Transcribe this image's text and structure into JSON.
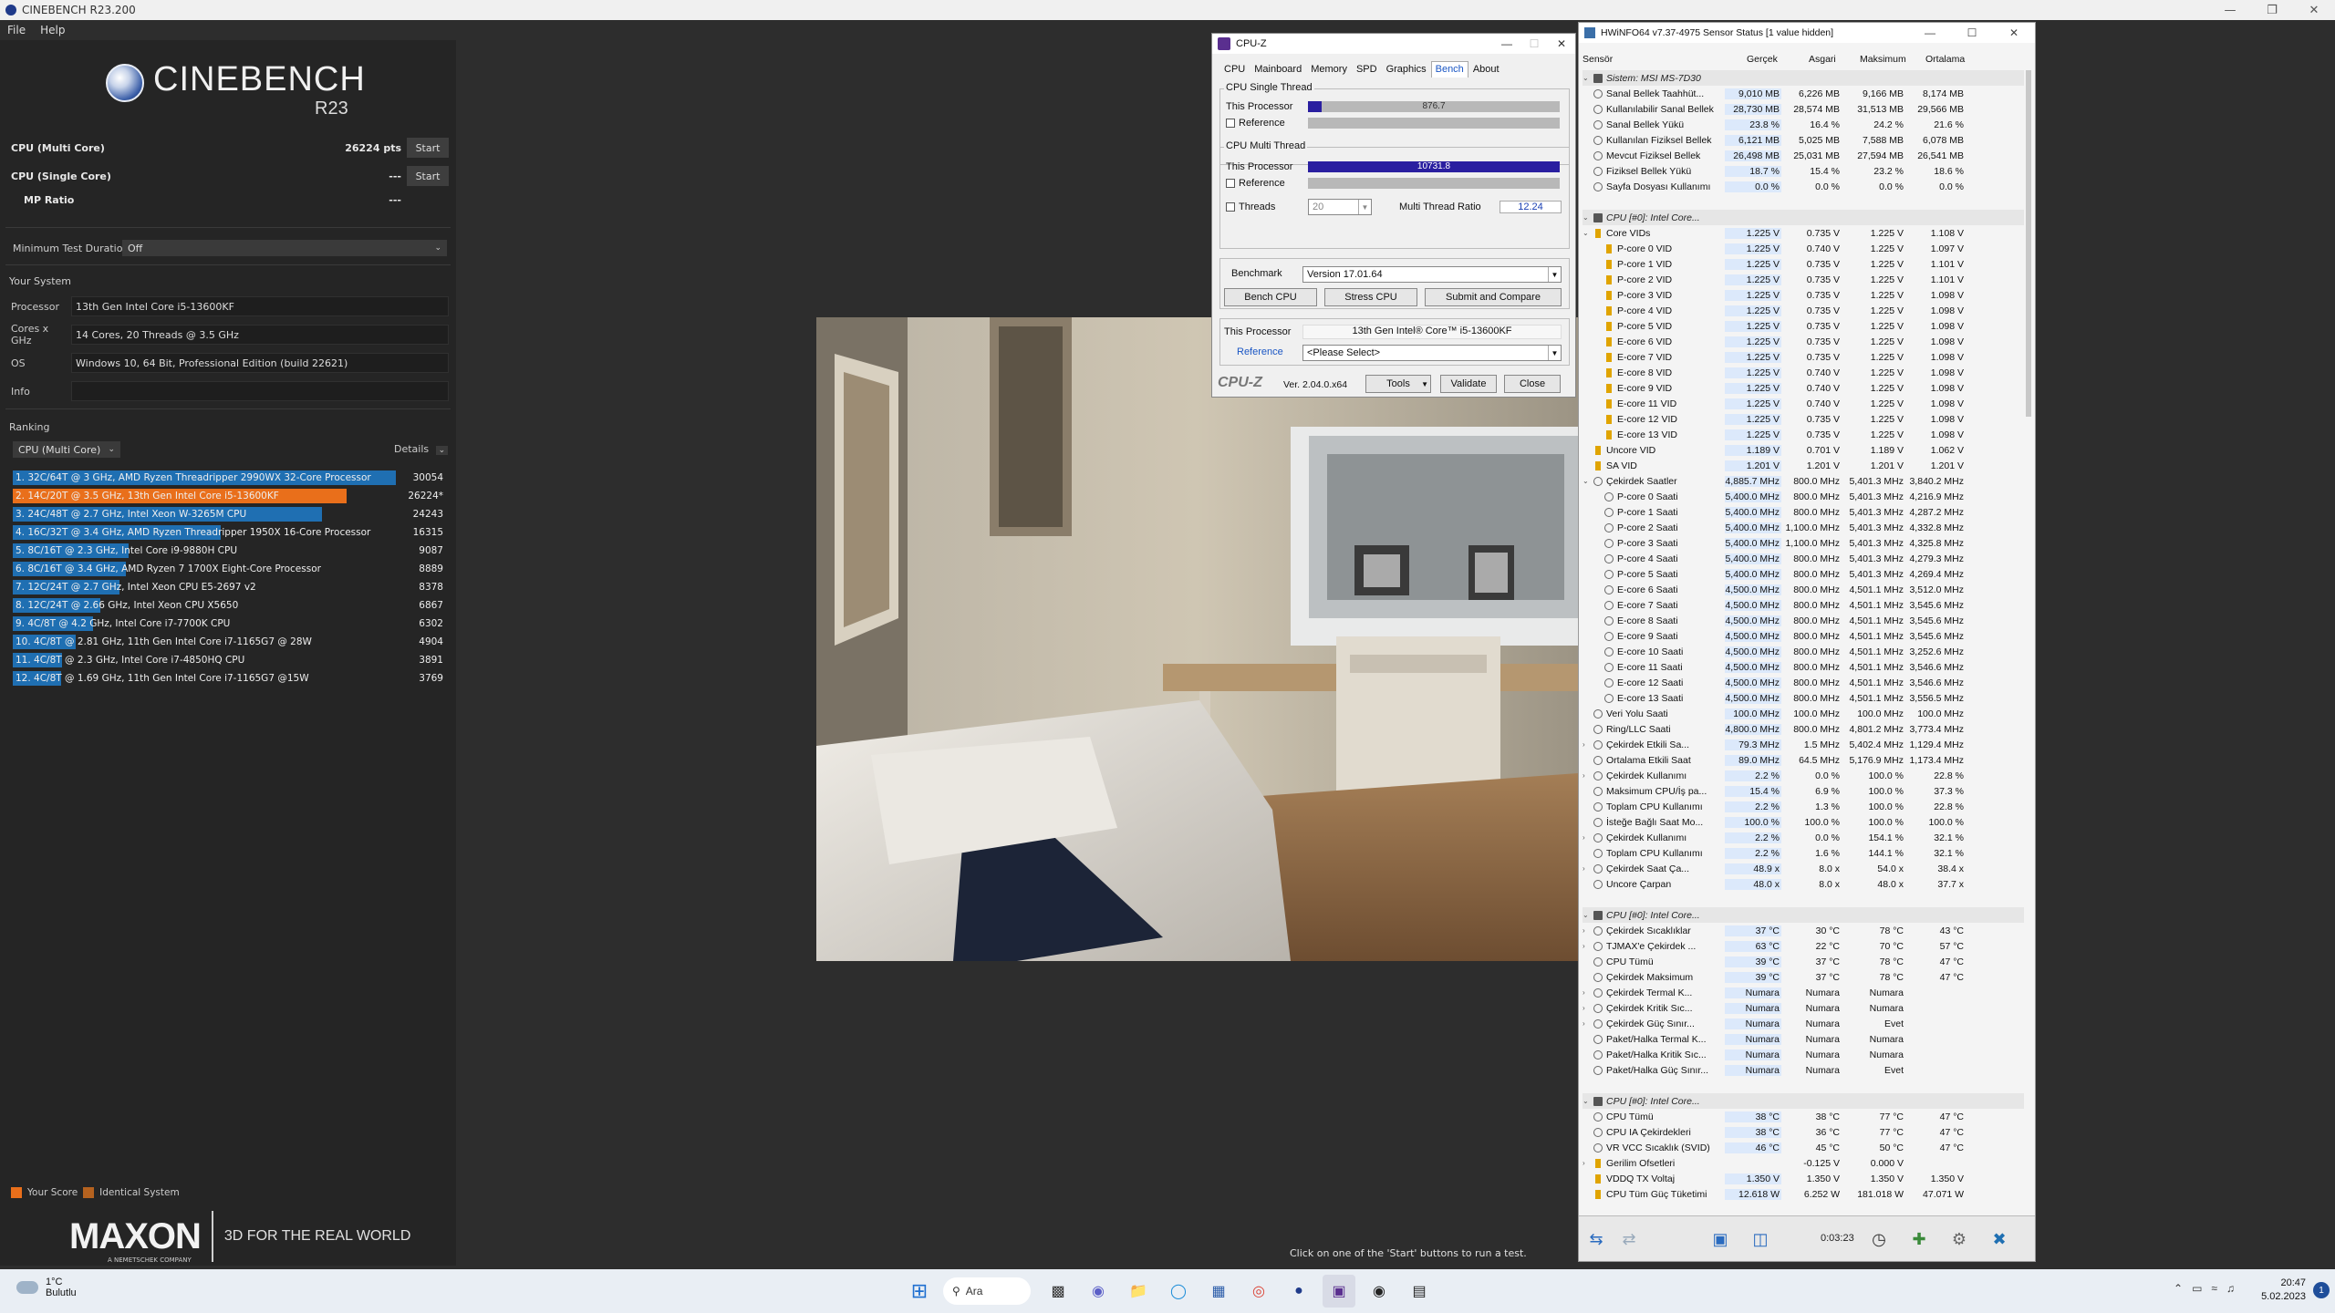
{
  "cinebench": {
    "title": "CINEBENCH R23.200",
    "menu": [
      "File",
      "Help"
    ],
    "logo_name": "CINEBENCH",
    "logo_version": "R23",
    "tests": [
      {
        "label": "CPU (Multi Core)",
        "score": "26224 pts",
        "button": "Start"
      },
      {
        "label": "CPU (Single Core)",
        "score": "---",
        "button": "Start"
      },
      {
        "label": "MP Ratio",
        "score": "---"
      }
    ],
    "min_duration_label": "Minimum Test Duration",
    "min_duration_value": "Off",
    "your_system_label": "Your System",
    "system": [
      {
        "label": "Processor",
        "value": "13th Gen Intel Core i5-13600KF"
      },
      {
        "label": "Cores x GHz",
        "value": "14 Cores, 20 Threads @ 3.5 GHz"
      },
      {
        "label": "OS",
        "value": "Windows 10, 64 Bit, Professional Edition (build 22621)"
      },
      {
        "label": "Info",
        "value": ""
      }
    ],
    "ranking_label": "Ranking",
    "ranking_filter": "CPU (Multi Core)",
    "details_label": "Details",
    "ranking": [
      {
        "text": "1. 32C/64T @ 3 GHz, AMD Ryzen Threadripper 2990WX 32-Core Processor",
        "score": "30054",
        "value": 30054,
        "you": false
      },
      {
        "text": "2. 14C/20T @ 3.5 GHz, 13th Gen Intel Core i5-13600KF",
        "score": "26224*",
        "value": 26224,
        "you": true
      },
      {
        "text": "3. 24C/48T @ 2.7 GHz, Intel Xeon W-3265M CPU",
        "score": "24243",
        "value": 24243,
        "you": false
      },
      {
        "text": "4. 16C/32T @ 3.4 GHz, AMD Ryzen Threadripper 1950X 16-Core Processor",
        "score": "16315",
        "value": 16315,
        "you": false
      },
      {
        "text": "5. 8C/16T @ 2.3 GHz, Intel Core i9-9880H CPU",
        "score": "9087",
        "value": 9087,
        "you": false
      },
      {
        "text": "6. 8C/16T @ 3.4 GHz, AMD Ryzen 7 1700X Eight-Core Processor",
        "score": "8889",
        "value": 8889,
        "you": false
      },
      {
        "text": "7. 12C/24T @ 2.7 GHz, Intel Xeon CPU E5-2697 v2",
        "score": "8378",
        "value": 8378,
        "you": false
      },
      {
        "text": "8. 12C/24T @ 2.66 GHz, Intel Xeon CPU X5650",
        "score": "6867",
        "value": 6867,
        "you": false
      },
      {
        "text": "9. 4C/8T @ 4.2 GHz, Intel Core i7-7700K CPU",
        "score": "6302",
        "value": 6302,
        "you": false
      },
      {
        "text": "10. 4C/8T @ 2.81 GHz, 11th Gen Intel Core i7-1165G7 @ 28W",
        "score": "4904",
        "value": 4904,
        "you": false
      },
      {
        "text": "11. 4C/8T @ 2.3 GHz, Intel Core i7-4850HQ CPU",
        "score": "3891",
        "value": 3891,
        "you": false
      },
      {
        "text": "12. 4C/8T @ 1.69 GHz, 11th Gen Intel Core i7-1165G7 @15W",
        "score": "3769",
        "value": 3769,
        "you": false
      }
    ],
    "legend_your_score": "Your Score",
    "legend_identical": "Identical System",
    "your_color": "#e96f1b",
    "identical_color": "#b5621f",
    "bar_color": "#1f6fb2",
    "maxon_logo": "MAXON",
    "maxon_sub": "A NEMETSCHEK COMPANY",
    "maxon_tag": "3D FOR THE REAL WORLD",
    "hint": "Click on one of the 'Start' buttons to run a test."
  },
  "cpuz": {
    "title": "CPU-Z",
    "tabs": [
      "CPU",
      "Mainboard",
      "Memory",
      "SPD",
      "Graphics",
      "Bench",
      "About"
    ],
    "active_tab": "Bench",
    "single_group": "CPU Single Thread",
    "multi_group": "CPU Multi Thread",
    "this_processor": "This Processor",
    "reference": "Reference",
    "single_value": "876.7",
    "single_fill": 0.055,
    "multi_value": "10731.8",
    "multi_fill": 1.0,
    "threads_label": "Threads",
    "threads_value": "20",
    "mt_ratio_label": "Multi Thread Ratio",
    "mt_ratio_value": "12.24",
    "benchmark_label": "Benchmark",
    "benchmark_value": "Version 17.01.64",
    "bench_cpu": "Bench CPU",
    "stress_cpu": "Stress CPU",
    "submit_compare": "Submit and Compare",
    "this_processor_value": "13th Gen Intel® Core™ i5-13600KF",
    "reference_select": "<Please Select>",
    "brand": "CPU-Z",
    "version": "Ver. 2.04.0.x64",
    "tools": "Tools",
    "validate": "Validate",
    "close": "Close"
  },
  "hwinfo": {
    "title": "HWiNFO64 v7.37-4975 Sensor Status [1 value hidden]",
    "headers": [
      "Sensör",
      "Gerçek",
      "Asgari",
      "Maksimum",
      "Ortalama"
    ],
    "rows": [
      {
        "t": "grp",
        "name": "Sistem: MSI MS-7D30",
        "exp": "⌄"
      },
      {
        "t": "r",
        "name": "Sanal Bellek Taahhüt...",
        "v": [
          "9,010 MB",
          "6,226 MB",
          "9,166 MB",
          "8,174 MB"
        ]
      },
      {
        "t": "r",
        "name": "Kullanılabilir Sanal Bellek",
        "v": [
          "28,730 MB",
          "28,574 MB",
          "31,513 MB",
          "29,566 MB"
        ]
      },
      {
        "t": "r",
        "name": "Sanal Bellek Yükü",
        "v": [
          "23.8 %",
          "16.4 %",
          "24.2 %",
          "21.6 %"
        ]
      },
      {
        "t": "r",
        "name": "Kullanılan Fiziksel Bellek",
        "v": [
          "6,121 MB",
          "5,025 MB",
          "7,588 MB",
          "6,078 MB"
        ]
      },
      {
        "t": "r",
        "name": "Mevcut Fiziksel Bellek",
        "v": [
          "26,498 MB",
          "25,031 MB",
          "27,594 MB",
          "26,541 MB"
        ]
      },
      {
        "t": "r",
        "name": "Fiziksel Bellek Yükü",
        "v": [
          "18.7 %",
          "15.4 %",
          "23.2 %",
          "18.6 %"
        ]
      },
      {
        "t": "r",
        "name": "Sayfa Dosyası Kullanımı",
        "v": [
          "0.0 %",
          "0.0 %",
          "0.0 %",
          "0.0 %"
        ]
      },
      {
        "t": "blank"
      },
      {
        "t": "grp",
        "name": "CPU [#0]: Intel Core...",
        "exp": "⌄"
      },
      {
        "t": "r",
        "name": "Core VIDs",
        "v": [
          "1.225 V",
          "0.735 V",
          "1.225 V",
          "1.108 V"
        ],
        "exp": "⌄",
        "ic": "v"
      },
      {
        "t": "r2",
        "name": "P-core 0 VID",
        "v": [
          "1.225 V",
          "0.740 V",
          "1.225 V",
          "1.097 V"
        ],
        "ic": "v"
      },
      {
        "t": "r2",
        "name": "P-core 1 VID",
        "v": [
          "1.225 V",
          "0.735 V",
          "1.225 V",
          "1.101 V"
        ],
        "ic": "v"
      },
      {
        "t": "r2",
        "name": "P-core 2 VID",
        "v": [
          "1.225 V",
          "0.735 V",
          "1.225 V",
          "1.101 V"
        ],
        "ic": "v"
      },
      {
        "t": "r2",
        "name": "P-core 3 VID",
        "v": [
          "1.225 V",
          "0.735 V",
          "1.225 V",
          "1.098 V"
        ],
        "ic": "v"
      },
      {
        "t": "r2",
        "name": "P-core 4 VID",
        "v": [
          "1.225 V",
          "0.735 V",
          "1.225 V",
          "1.098 V"
        ],
        "ic": "v"
      },
      {
        "t": "r2",
        "name": "P-core 5 VID",
        "v": [
          "1.225 V",
          "0.735 V",
          "1.225 V",
          "1.098 V"
        ],
        "ic": "v"
      },
      {
        "t": "r2",
        "name": "E-core 6 VID",
        "v": [
          "1.225 V",
          "0.735 V",
          "1.225 V",
          "1.098 V"
        ],
        "ic": "v"
      },
      {
        "t": "r2",
        "name": "E-core 7 VID",
        "v": [
          "1.225 V",
          "0.735 V",
          "1.225 V",
          "1.098 V"
        ],
        "ic": "v"
      },
      {
        "t": "r2",
        "name": "E-core 8 VID",
        "v": [
          "1.225 V",
          "0.740 V",
          "1.225 V",
          "1.098 V"
        ],
        "ic": "v"
      },
      {
        "t": "r2",
        "name": "E-core 9 VID",
        "v": [
          "1.225 V",
          "0.740 V",
          "1.225 V",
          "1.098 V"
        ],
        "ic": "v"
      },
      {
        "t": "r2",
        "name": "E-core 11 VID",
        "v": [
          "1.225 V",
          "0.740 V",
          "1.225 V",
          "1.098 V"
        ],
        "ic": "v"
      },
      {
        "t": "r2",
        "name": "E-core 12 VID",
        "v": [
          "1.225 V",
          "0.735 V",
          "1.225 V",
          "1.098 V"
        ],
        "ic": "v"
      },
      {
        "t": "r2",
        "name": "E-core 13 VID",
        "v": [
          "1.225 V",
          "0.735 V",
          "1.225 V",
          "1.098 V"
        ],
        "ic": "v"
      },
      {
        "t": "r",
        "name": "Uncore VID",
        "v": [
          "1.189 V",
          "0.701 V",
          "1.189 V",
          "1.062 V"
        ],
        "ic": "v"
      },
      {
        "t": "r",
        "name": "SA VID",
        "v": [
          "1.201 V",
          "1.201 V",
          "1.201 V",
          "1.201 V"
        ],
        "ic": "v"
      },
      {
        "t": "r",
        "name": "Çekirdek Saatler",
        "v": [
          "4,885.7 MHz",
          "800.0 MHz",
          "5,401.3 MHz",
          "3,840.2 MHz"
        ],
        "exp": "⌄"
      },
      {
        "t": "r2",
        "name": "P-core 0 Saati",
        "v": [
          "5,400.0 MHz",
          "800.0 MHz",
          "5,401.3 MHz",
          "4,216.9 MHz"
        ]
      },
      {
        "t": "r2",
        "name": "P-core 1 Saati",
        "v": [
          "5,400.0 MHz",
          "800.0 MHz",
          "5,401.3 MHz",
          "4,287.2 MHz"
        ]
      },
      {
        "t": "r2",
        "name": "P-core 2 Saati",
        "v": [
          "5,400.0 MHz",
          "1,100.0 MHz",
          "5,401.3 MHz",
          "4,332.8 MHz"
        ]
      },
      {
        "t": "r2",
        "name": "P-core 3 Saati",
        "v": [
          "5,400.0 MHz",
          "1,100.0 MHz",
          "5,401.3 MHz",
          "4,325.8 MHz"
        ]
      },
      {
        "t": "r2",
        "name": "P-core 4 Saati",
        "v": [
          "5,400.0 MHz",
          "800.0 MHz",
          "5,401.3 MHz",
          "4,279.3 MHz"
        ]
      },
      {
        "t": "r2",
        "name": "P-core 5 Saati",
        "v": [
          "5,400.0 MHz",
          "800.0 MHz",
          "5,401.3 MHz",
          "4,269.4 MHz"
        ]
      },
      {
        "t": "r2",
        "name": "E-core 6 Saati",
        "v": [
          "4,500.0 MHz",
          "800.0 MHz",
          "4,501.1 MHz",
          "3,512.0 MHz"
        ]
      },
      {
        "t": "r2",
        "name": "E-core 7 Saati",
        "v": [
          "4,500.0 MHz",
          "800.0 MHz",
          "4,501.1 MHz",
          "3,545.6 MHz"
        ]
      },
      {
        "t": "r2",
        "name": "E-core 8 Saati",
        "v": [
          "4,500.0 MHz",
          "800.0 MHz",
          "4,501.1 MHz",
          "3,545.6 MHz"
        ]
      },
      {
        "t": "r2",
        "name": "E-core 9 Saati",
        "v": [
          "4,500.0 MHz",
          "800.0 MHz",
          "4,501.1 MHz",
          "3,545.6 MHz"
        ]
      },
      {
        "t": "r2",
        "name": "E-core 10 Saati",
        "v": [
          "4,500.0 MHz",
          "800.0 MHz",
          "4,501.1 MHz",
          "3,252.6 MHz"
        ]
      },
      {
        "t": "r2",
        "name": "E-core 11 Saati",
        "v": [
          "4,500.0 MHz",
          "800.0 MHz",
          "4,501.1 MHz",
          "3,546.6 MHz"
        ]
      },
      {
        "t": "r2",
        "name": "E-core 12 Saati",
        "v": [
          "4,500.0 MHz",
          "800.0 MHz",
          "4,501.1 MHz",
          "3,546.6 MHz"
        ]
      },
      {
        "t": "r2",
        "name": "E-core 13 Saati",
        "v": [
          "4,500.0 MHz",
          "800.0 MHz",
          "4,501.1 MHz",
          "3,556.5 MHz"
        ]
      },
      {
        "t": "r",
        "name": "Veri Yolu Saati",
        "v": [
          "100.0 MHz",
          "100.0 MHz",
          "100.0 MHz",
          "100.0 MHz"
        ]
      },
      {
        "t": "r",
        "name": "Ring/LLC Saati",
        "v": [
          "4,800.0 MHz",
          "800.0 MHz",
          "4,801.2 MHz",
          "3,773.4 MHz"
        ]
      },
      {
        "t": "r",
        "name": "Çekirdek Etkili Sa...",
        "v": [
          "79.3 MHz",
          "1.5 MHz",
          "5,402.4 MHz",
          "1,129.4 MHz"
        ],
        "exp": "›"
      },
      {
        "t": "r",
        "name": "Ortalama Etkili Saat",
        "v": [
          "89.0 MHz",
          "64.5 MHz",
          "5,176.9 MHz",
          "1,173.4 MHz"
        ]
      },
      {
        "t": "r",
        "name": "Çekirdek Kullanımı",
        "v": [
          "2.2 %",
          "0.0 %",
          "100.0 %",
          "22.8 %"
        ],
        "exp": "›"
      },
      {
        "t": "r",
        "name": "Maksimum CPU/İş pa...",
        "v": [
          "15.4 %",
          "6.9 %",
          "100.0 %",
          "37.3 %"
        ]
      },
      {
        "t": "r",
        "name": "Toplam CPU Kullanımı",
        "v": [
          "2.2 %",
          "1.3 %",
          "100.0 %",
          "22.8 %"
        ]
      },
      {
        "t": "r",
        "name": "İsteğe Bağlı Saat Mo...",
        "v": [
          "100.0 %",
          "100.0 %",
          "100.0 %",
          "100.0 %"
        ]
      },
      {
        "t": "r",
        "name": "Çekirdek Kullanımı",
        "v": [
          "2.2 %",
          "0.0 %",
          "154.1 %",
          "32.1 %"
        ],
        "exp": "›"
      },
      {
        "t": "r",
        "name": "Toplam CPU Kullanımı",
        "v": [
          "2.2 %",
          "1.6 %",
          "144.1 %",
          "32.1 %"
        ]
      },
      {
        "t": "r",
        "name": "Çekirdek Saat Ça...",
        "v": [
          "48.9 x",
          "8.0 x",
          "54.0 x",
          "38.4 x"
        ],
        "exp": "›"
      },
      {
        "t": "r",
        "name": "Uncore Çarpan",
        "v": [
          "48.0 x",
          "8.0 x",
          "48.0 x",
          "37.7 x"
        ]
      },
      {
        "t": "blank"
      },
      {
        "t": "grp",
        "name": "CPU [#0]: Intel Core...",
        "exp": "⌄"
      },
      {
        "t": "r",
        "name": "Çekirdek Sıcaklıklar",
        "v": [
          "37 °C",
          "30 °C",
          "78 °C",
          "43 °C"
        ],
        "exp": "›"
      },
      {
        "t": "r",
        "name": "TJMAX'e Çekirdek ...",
        "v": [
          "63 °C",
          "22 °C",
          "70 °C",
          "57 °C"
        ],
        "exp": "›"
      },
      {
        "t": "r",
        "name": "CPU Tümü",
        "v": [
          "39 °C",
          "37 °C",
          "78 °C",
          "47 °C"
        ]
      },
      {
        "t": "r",
        "name": "Çekirdek Maksimum",
        "v": [
          "39 °C",
          "37 °C",
          "78 °C",
          "47 °C"
        ]
      },
      {
        "t": "r",
        "name": "Çekirdek Termal K...",
        "v": [
          "Numara",
          "Numara",
          "Numara",
          ""
        ],
        "exp": "›"
      },
      {
        "t": "r",
        "name": "Çekirdek Kritik Sıc...",
        "v": [
          "Numara",
          "Numara",
          "Numara",
          ""
        ],
        "exp": "›"
      },
      {
        "t": "r",
        "name": "Çekirdek Güç Sınır...",
        "v": [
          "Numara",
          "Numara",
          "Evet",
          ""
        ],
        "exp": "›"
      },
      {
        "t": "r",
        "name": "Paket/Halka Termal K...",
        "v": [
          "Numara",
          "Numara",
          "Numara",
          ""
        ]
      },
      {
        "t": "r",
        "name": "Paket/Halka Kritik Sıc...",
        "v": [
          "Numara",
          "Numara",
          "Numara",
          ""
        ]
      },
      {
        "t": "r",
        "name": "Paket/Halka Güç Sınır...",
        "v": [
          "Numara",
          "Numara",
          "Evet",
          ""
        ]
      },
      {
        "t": "blank"
      },
      {
        "t": "grp",
        "name": "CPU [#0]: Intel Core...",
        "exp": "⌄"
      },
      {
        "t": "r",
        "name": "CPU Tümü",
        "v": [
          "38 °C",
          "38 °C",
          "77 °C",
          "47 °C"
        ]
      },
      {
        "t": "r",
        "name": "CPU IA Çekirdekleri",
        "v": [
          "38 °C",
          "36 °C",
          "77 °C",
          "47 °C"
        ]
      },
      {
        "t": "r",
        "name": "VR VCC Sıcaklık (SVID)",
        "v": [
          "46 °C",
          "45 °C",
          "50 °C",
          "47 °C"
        ]
      },
      {
        "t": "r",
        "name": "Gerilim Ofsetleri",
        "v": [
          "",
          "-0.125 V",
          "0.000 V",
          ""
        ],
        "exp": "›",
        "ic": "v"
      },
      {
        "t": "r",
        "name": "VDDQ TX Voltaj",
        "v": [
          "1.350 V",
          "1.350 V",
          "1.350 V",
          "1.350 V"
        ],
        "ic": "v"
      },
      {
        "t": "r",
        "name": "CPU Tüm Güç Tüketimi",
        "v": [
          "12.618 W",
          "6.252 W",
          "181.018 W",
          "47.071 W"
        ],
        "ic": "v"
      }
    ],
    "elapsed": "0:03:23"
  },
  "taskbar": {
    "temp": "1°C",
    "weather": "Bulutlu",
    "search": "Ara",
    "time": "20:47",
    "date": "5.02.2023"
  }
}
